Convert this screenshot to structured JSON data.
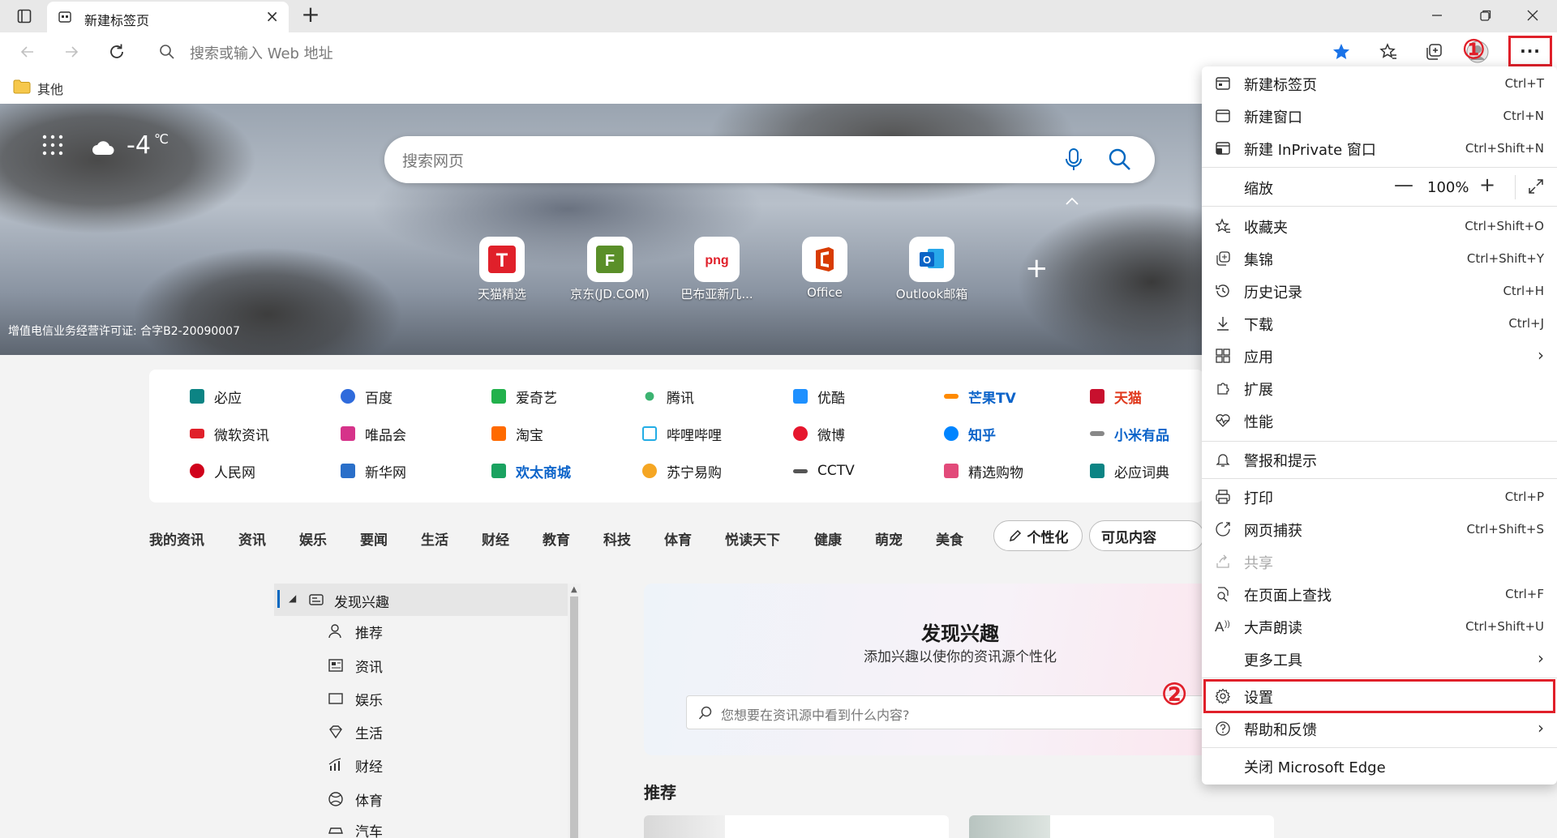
{
  "tab": {
    "title": "新建标签页"
  },
  "address": {
    "placeholder": "搜索或输入 Web 地址"
  },
  "bookmarks": {
    "folder_label": "其他"
  },
  "markers": {
    "one": "①",
    "two": "②"
  },
  "hero": {
    "weather_temp": "-4",
    "weather_unit": "℃",
    "search_placeholder": "搜索网页",
    "license": "增值电信业务经营许可证: 合字B2-20090007",
    "quick_links": [
      {
        "label": "天猫精选",
        "glyph": "T",
        "color": "#e0202a"
      },
      {
        "label": "京东(JD.COM)",
        "glyph": "F",
        "color": "#5a8f29"
      },
      {
        "label": "巴布亚新几...",
        "glyph": "png",
        "color": "#e0202a"
      },
      {
        "label": "Office",
        "glyph": "O",
        "color": "#d83b01"
      },
      {
        "label": "Outlook邮箱",
        "glyph": "O",
        "color": "#0a64c6"
      }
    ]
  },
  "sites": [
    {
      "label": "必应",
      "color": "#0c8484",
      "bold": false,
      "highlight": ""
    },
    {
      "label": "百度",
      "color": "#2f6bdc",
      "bold": false,
      "highlight": ""
    },
    {
      "label": "爱奇艺",
      "color": "#22b14c",
      "bold": false,
      "highlight": ""
    },
    {
      "label": "腾讯",
      "color": "#3cb371",
      "bold": false,
      "highlight": ""
    },
    {
      "label": "优酷",
      "color": "#1e90ff",
      "bold": false,
      "highlight": ""
    },
    {
      "label": "芒果TV",
      "color": "#ff8a00",
      "bold": true,
      "highlight": "#0b63c9"
    },
    {
      "label": "天猫",
      "color": "#c8102e",
      "bold": true,
      "highlight": "#e03a1e"
    },
    {
      "label": "微软资讯",
      "color": "#e0202a",
      "bold": false,
      "highlight": ""
    },
    {
      "label": "唯品会",
      "color": "#d6338a",
      "bold": false,
      "highlight": ""
    },
    {
      "label": "淘宝",
      "color": "#ff6a00",
      "bold": false,
      "highlight": ""
    },
    {
      "label": "哔哩哔哩",
      "color": "#23ade5",
      "bold": false,
      "highlight": ""
    },
    {
      "label": "微博",
      "color": "#e6162d",
      "bold": false,
      "highlight": ""
    },
    {
      "label": "知乎",
      "color": "#0084ff",
      "bold": true,
      "highlight": "#0b63c9"
    },
    {
      "label": "小米有品",
      "color": "#888888",
      "bold": true,
      "highlight": "#0b63c9"
    },
    {
      "label": "人民网",
      "color": "#d0021b",
      "bold": false,
      "highlight": ""
    },
    {
      "label": "新华网",
      "color": "#2a6fc9",
      "bold": false,
      "highlight": ""
    },
    {
      "label": "欢太商城",
      "color": "#1aa260",
      "bold": true,
      "highlight": "#0b63c9"
    },
    {
      "label": "苏宁易购",
      "color": "#f5a623",
      "bold": false,
      "highlight": ""
    },
    {
      "label": "CCTV",
      "color": "#555555",
      "bold": false,
      "highlight": ""
    },
    {
      "label": "精选购物",
      "color": "#e24a7a",
      "bold": false,
      "highlight": ""
    },
    {
      "label": "必应词典",
      "color": "#0c8484",
      "bold": false,
      "highlight": ""
    }
  ],
  "feed": {
    "tabs": [
      "我的资讯",
      "资讯",
      "娱乐",
      "要闻",
      "生活",
      "财经",
      "教育",
      "科技",
      "体育",
      "悦读天下",
      "健康",
      "萌宠",
      "美食"
    ],
    "personalize": "个性化",
    "visible_content": "可见内容"
  },
  "tree": {
    "header": "发现兴趣",
    "items": [
      "推荐",
      "资讯",
      "娱乐",
      "生活",
      "财经",
      "体育",
      "汽车"
    ]
  },
  "discover": {
    "title": "发现兴趣",
    "subtitle": "添加兴趣以使你的资讯源个性化",
    "search_placeholder": "您想要在资讯源中看到什么内容?",
    "recommend": "推荐"
  },
  "menu": {
    "new_tab": {
      "label": "新建标签页",
      "shortcut": "Ctrl+T"
    },
    "new_window": {
      "label": "新建窗口",
      "shortcut": "Ctrl+N"
    },
    "new_inprivate": {
      "label": "新建 InPrivate 窗口",
      "shortcut": "Ctrl+Shift+N"
    },
    "zoom": {
      "label": "缩放",
      "minus": "—",
      "value": "100%",
      "plus": "+"
    },
    "favorites": {
      "label": "收藏夹",
      "shortcut": "Ctrl+Shift+O"
    },
    "collections": {
      "label": "集锦",
      "shortcut": "Ctrl+Shift+Y"
    },
    "history": {
      "label": "历史记录",
      "shortcut": "Ctrl+H"
    },
    "downloads": {
      "label": "下载",
      "shortcut": "Ctrl+J"
    },
    "apps": {
      "label": "应用"
    },
    "extensions": {
      "label": "扩展"
    },
    "performance": {
      "label": "性能"
    },
    "alerts": {
      "label": "警报和提示"
    },
    "print": {
      "label": "打印",
      "shortcut": "Ctrl+P"
    },
    "web_capture": {
      "label": "网页捕获",
      "shortcut": "Ctrl+Shift+S"
    },
    "share": {
      "label": "共享"
    },
    "find": {
      "label": "在页面上查找",
      "shortcut": "Ctrl+F"
    },
    "read_aloud": {
      "label": "大声朗读",
      "shortcut": "Ctrl+Shift+U"
    },
    "more_tools": {
      "label": "更多工具"
    },
    "settings": {
      "label": "设置"
    },
    "help": {
      "label": "帮助和反馈"
    },
    "close_edge": {
      "label": "关闭 Microsoft Edge"
    }
  }
}
